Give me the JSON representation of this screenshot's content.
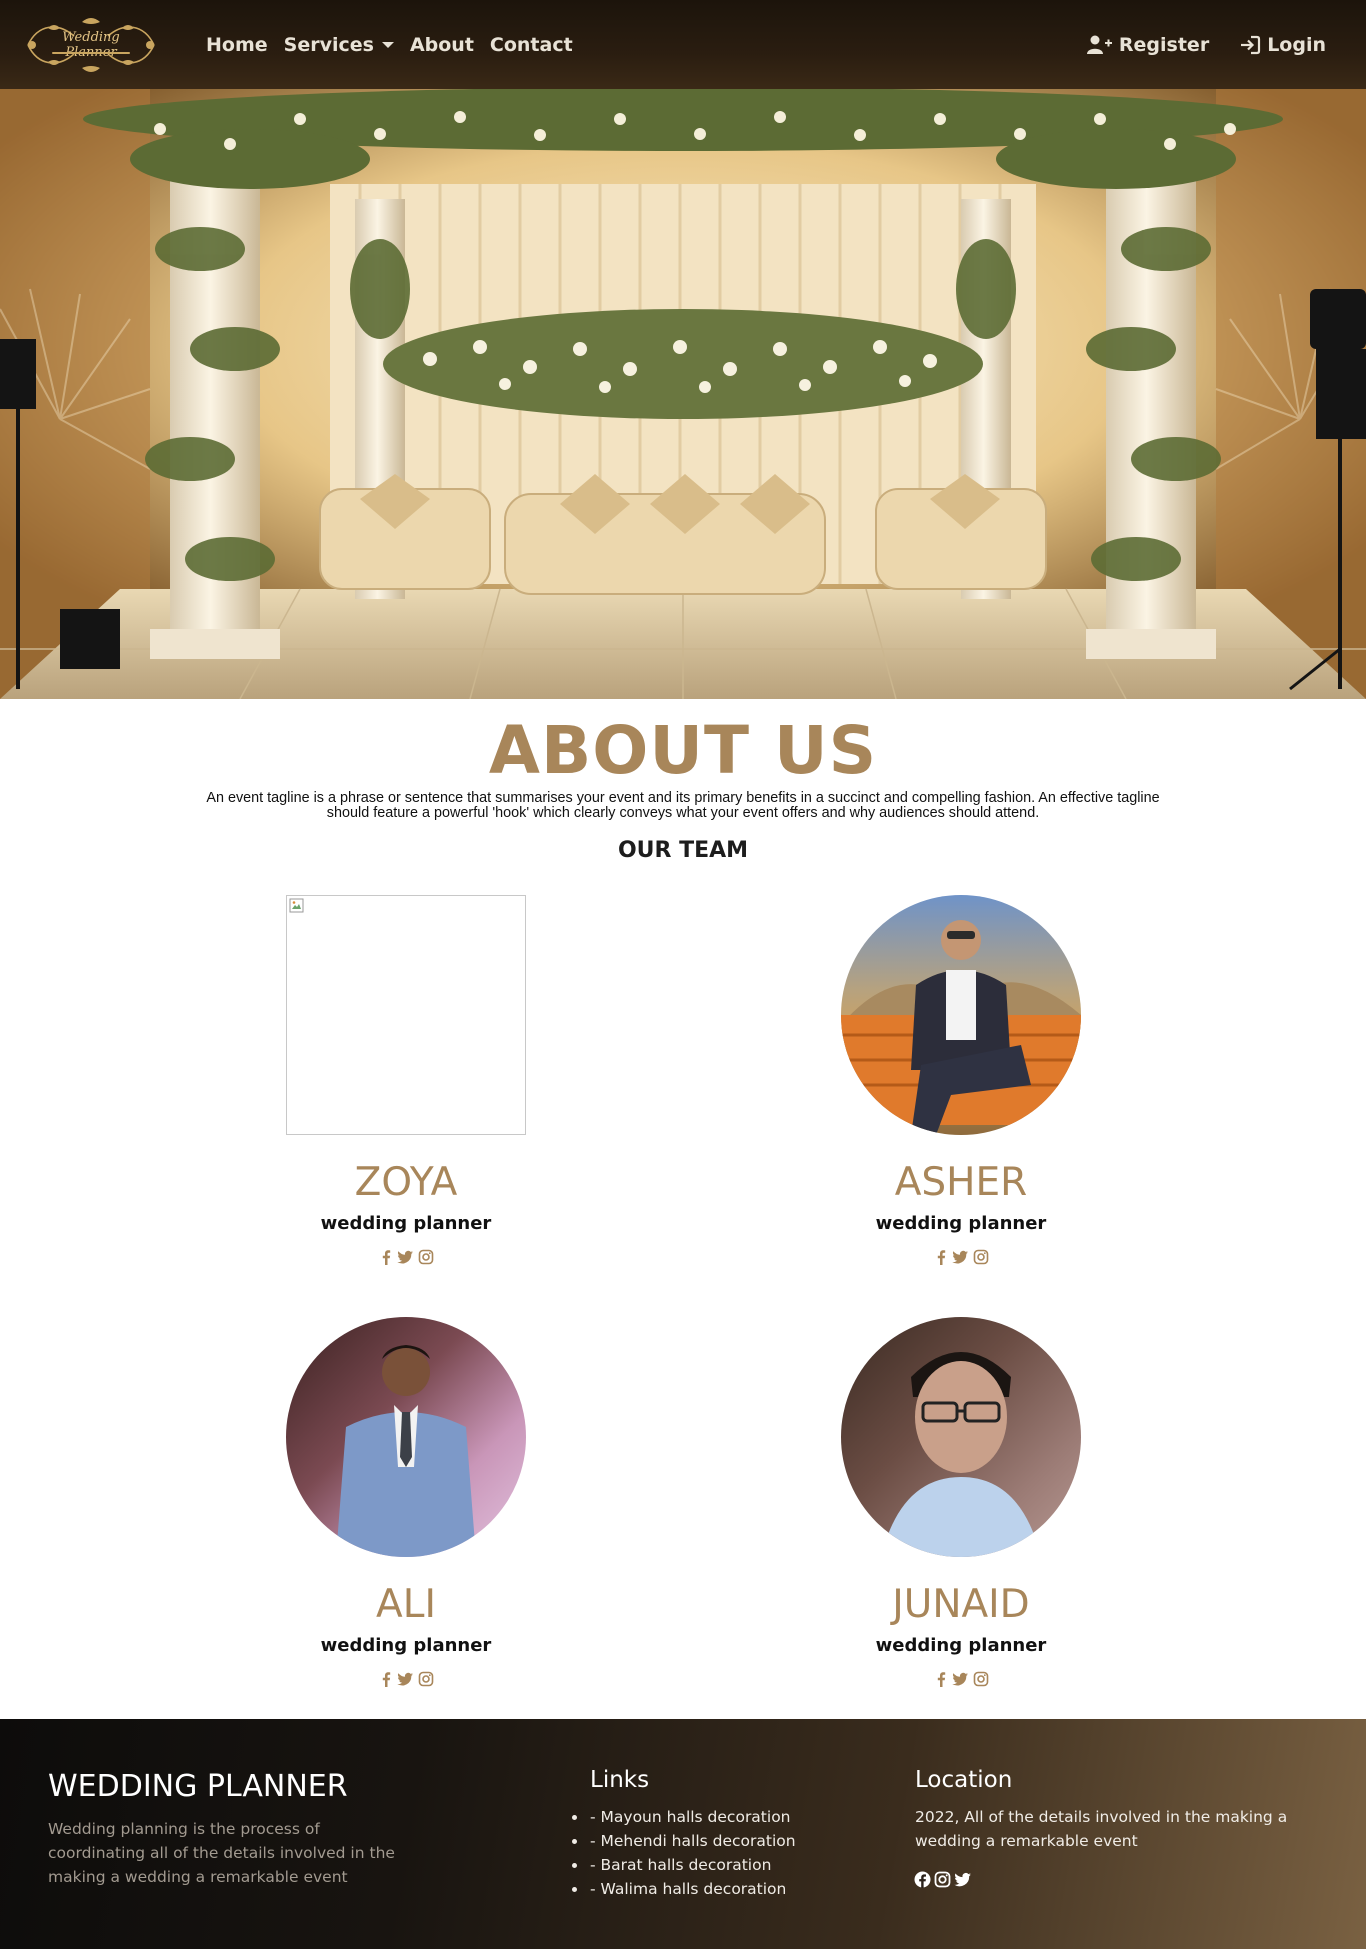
{
  "nav": {
    "logo_text": "Wedding Planner",
    "links": [
      {
        "label": "Home"
      },
      {
        "label": "Services"
      },
      {
        "label": "About"
      },
      {
        "label": "Contact"
      }
    ],
    "register_label": "Register",
    "login_label": "Login"
  },
  "about": {
    "title": "ABOUT US",
    "text": "An event tagline is a phrase or sentence that summarises your event and its primary benefits in a succinct and compelling fashion. An effective tagline should feature a powerful 'hook' which clearly conveys what your event offers and why audiences should attend.",
    "team_title": "OUR TEAM"
  },
  "team": [
    {
      "name": "ZOYA",
      "role": "wedding planner"
    },
    {
      "name": "ASHER",
      "role": "wedding planner"
    },
    {
      "name": "ALI",
      "role": "wedding planner"
    },
    {
      "name": "JUNAID",
      "role": "wedding planner"
    }
  ],
  "footer": {
    "title": "WEDDING PLANNER",
    "description": "Wedding planning is the process of coordinating all of the details involved in the making a wedding a remarkable event",
    "links_title": "Links",
    "links": [
      "- Mayoun halls decoration",
      "- Mehendi halls decoration",
      "- Barat halls decoration",
      "- Walima halls decoration"
    ],
    "location_title": "Location",
    "location_text": "2022, All of the details involved in the making a wedding a remarkable event"
  },
  "colors": {
    "accent": "#a8865a",
    "nav_bg": "#2a1d10",
    "footer_start": "#0d0c0b",
    "footer_end": "#7a6142"
  },
  "icons": [
    "user-plus-icon",
    "login-icon",
    "facebook-icon",
    "twitter-icon",
    "instagram-icon"
  ]
}
